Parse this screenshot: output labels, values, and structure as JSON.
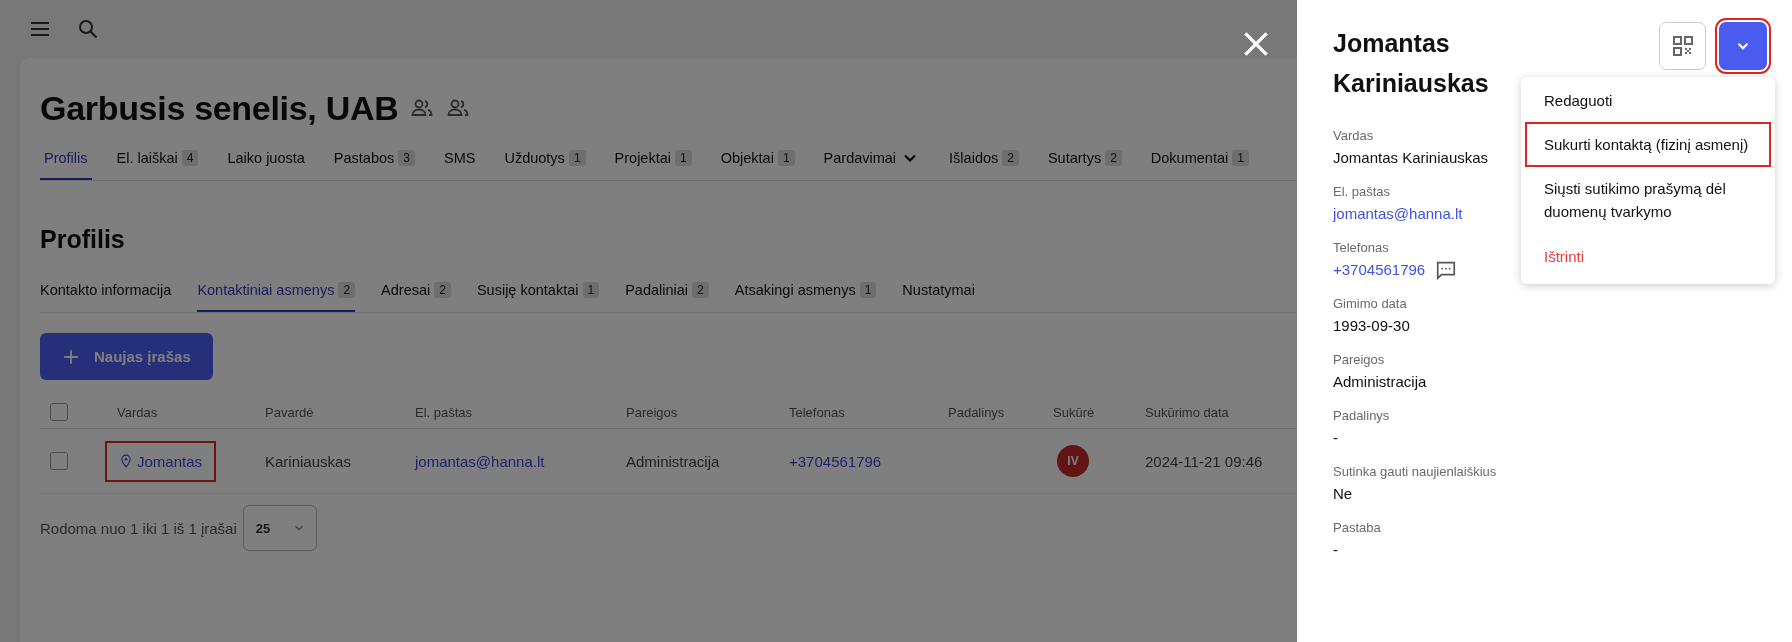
{
  "company": {
    "title": "Garbusis senelis, UAB"
  },
  "tabs": [
    {
      "label": "Profilis",
      "selected": true,
      "kind": "plain"
    },
    {
      "label": "El. laiškai",
      "count": "4",
      "selected": false,
      "kind": "plain"
    },
    {
      "label": "Laiko juosta",
      "selected": false,
      "kind": "plain"
    },
    {
      "label": "Pastabos",
      "count": "3",
      "selected": false,
      "kind": "plain"
    },
    {
      "label": "SMS",
      "selected": false,
      "kind": "plain"
    },
    {
      "label": "Užduotys",
      "count": "1",
      "selected": false,
      "kind": "plain"
    },
    {
      "label": "Projektai",
      "count": "1",
      "selected": false,
      "kind": "plain"
    },
    {
      "label": "Objektai",
      "count": "1",
      "selected": false,
      "kind": "plain"
    },
    {
      "label": "Pardavimai",
      "selected": false,
      "kind": "menu"
    },
    {
      "label": "Išlaidos",
      "count": "2",
      "selected": false,
      "kind": "plain"
    },
    {
      "label": "Sutartys",
      "count": "2",
      "selected": false,
      "kind": "plain"
    },
    {
      "label": "Dokumentai",
      "count": "1",
      "selected": false,
      "kind": "plain"
    }
  ],
  "section": {
    "title": "Profilis"
  },
  "subtabs": [
    {
      "label": "Kontakto informacija",
      "selected": false
    },
    {
      "label": "Kontaktiniai asmenys",
      "count": "2",
      "selected": true
    },
    {
      "label": "Adresai",
      "count": "2",
      "selected": false
    },
    {
      "label": "Susiję kontaktai",
      "count": "1",
      "selected": false
    },
    {
      "label": "Padaliniai",
      "count": "2",
      "selected": false
    },
    {
      "label": "Atsakingi asmenys",
      "count": "1",
      "selected": false
    },
    {
      "label": "Nustatymai",
      "selected": false
    }
  ],
  "new_button": {
    "label": "Naujas įrašas"
  },
  "table": {
    "select_all_checked": false,
    "columns": [
      "Vardas",
      "Pavardė",
      "El. paštas",
      "Pareigos",
      "Telefonas",
      "Padalinys",
      "Sukūrė",
      "Sukūrimo data"
    ],
    "rows": [
      {
        "checked": false,
        "first_name": "Jomantas",
        "highlighted": true,
        "last_name": "Kariniauskas",
        "email": "jomantas@hanna.lt",
        "role": "Administracija",
        "phone": "+3704561796",
        "creator": "IV",
        "created": "2024-11-21 09:46"
      }
    ]
  },
  "pagination": {
    "summary": "Rodoma nuo 1 iki 1 iš 1 įrašai",
    "page_size": "25"
  },
  "drawer": {
    "title": "Jomantas Kariniauskas",
    "dropdown_highlighted": true,
    "fields": [
      {
        "label": "Vardas",
        "value": "Jomantas Kariniauskas",
        "kind": "text"
      },
      {
        "label": "El. paštas",
        "value": "jomantas@hanna.lt",
        "kind": "link"
      },
      {
        "label": "Telefonas",
        "value": "+3704561796",
        "kind": "phone"
      },
      {
        "label": "Gimimo data",
        "value": "1993-09-30",
        "kind": "text"
      },
      {
        "label": "Pareigos",
        "value": "Administracija",
        "kind": "text"
      },
      {
        "label": "Padalinys",
        "value": "-",
        "kind": "text"
      },
      {
        "label": "Sutinka gauti naujienlaiškius",
        "value": "Ne",
        "kind": "text"
      },
      {
        "label": "Pastaba",
        "value": "-",
        "kind": "text"
      }
    ],
    "menu": [
      {
        "label": "Redaguoti",
        "kind": "normal",
        "highlighted": false
      },
      {
        "label": "Sukurti kontaktą (fizinį asmenį)",
        "kind": "normal",
        "highlighted": true
      },
      {
        "label": "Siųsti sutikimo prašymą dėl duomenų tvarkymo",
        "kind": "normal",
        "highlighted": false
      },
      {
        "label": "Ištrinti",
        "kind": "danger",
        "highlighted": false
      }
    ]
  }
}
